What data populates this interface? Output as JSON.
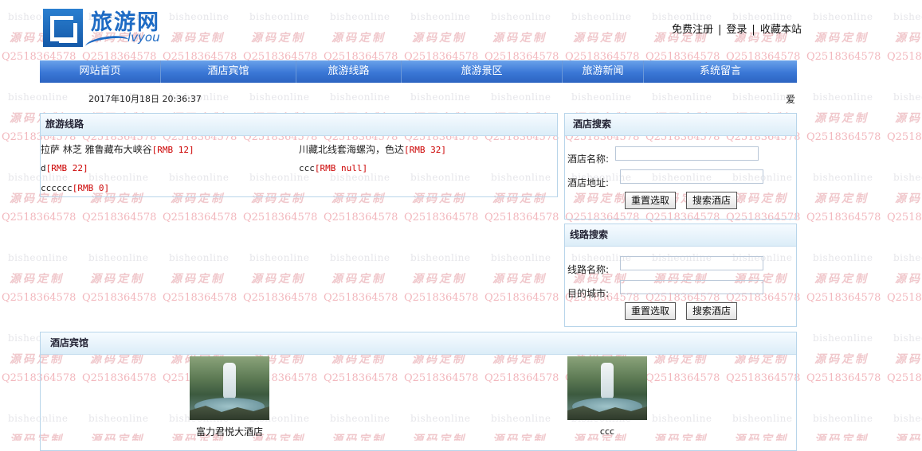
{
  "header": {
    "logo_cn": "旅游网",
    "logo_en": "lvyou",
    "links": [
      "免费注册",
      "登录",
      "收藏本站"
    ]
  },
  "watermark": {
    "line1": "bisheonline",
    "line2": "源码定制",
    "line3": "Q2518364578"
  },
  "nav": {
    "items": [
      "网站首页",
      "酒店宾馆",
      "旅游线路",
      "旅游景区",
      "旅游新闻",
      "系统留言"
    ]
  },
  "datetime": "2017年10月18日 20:36:37",
  "marquee": "爱",
  "routes": {
    "title": "旅游线路",
    "items": [
      {
        "name": "拉萨 林芝 雅鲁藏布大峡谷",
        "price": "[RMB 12]"
      },
      {
        "name": "川藏北线套海螺沟，色达",
        "price": "[RMB 32]"
      },
      {
        "name": "d",
        "price": "[RMB 22]"
      },
      {
        "name": "ccc",
        "price": "[RMB null]"
      },
      {
        "name": "cccccc",
        "price": "[RMB 0]"
      }
    ]
  },
  "hotel_search": {
    "title": "酒店搜索",
    "name_label": "酒店名称:",
    "name_value": "",
    "address_label": "酒店地址:",
    "address_value": "",
    "reset_label": "重置选取",
    "search_label": "搜索酒店"
  },
  "route_search": {
    "title": "线路搜索",
    "name_label": "线路名称:",
    "name_value": "",
    "city_label": "目的城市:",
    "city_value": "",
    "reset_label": "重置选取",
    "search_label": "搜索酒店"
  },
  "hotels": {
    "title": "酒店宾馆",
    "items": [
      {
        "name": "富力君悦大酒店",
        "image": "waterfall-photo"
      },
      {
        "name": "ccc",
        "image": "waterfall-photo"
      }
    ]
  }
}
